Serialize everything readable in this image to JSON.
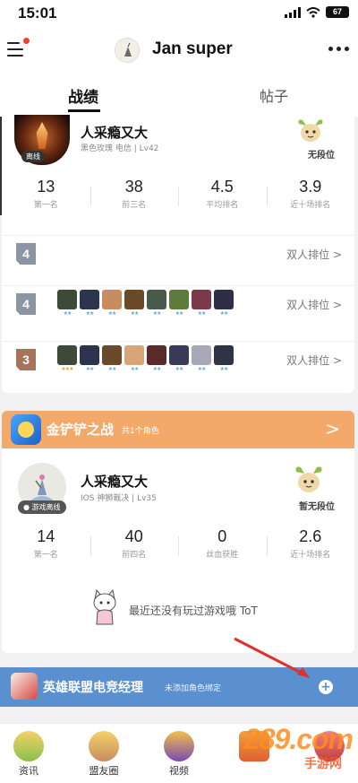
{
  "status_bar": {
    "time": "15:01",
    "battery": "67"
  },
  "header": {
    "username": "Jan  super"
  },
  "tabs": [
    {
      "label": "战绩"
    },
    {
      "label": "帖子"
    }
  ],
  "lol_card": {
    "player_name": "人采瘾又大",
    "player_sub": "黑色玫瑰  电信 | Lv42",
    "status_tag": "离线",
    "rank_label": "无段位",
    "stats": [
      {
        "value": "13",
        "label": "第一名"
      },
      {
        "value": "38",
        "label": "前三名"
      },
      {
        "value": "4.5",
        "label": "平均排名"
      },
      {
        "value": "3.9",
        "label": "近十场排名"
      }
    ],
    "matches": [
      {
        "place": "4",
        "mode": "双人排位 >"
      },
      {
        "place": "4",
        "mode": "双人排位 >"
      },
      {
        "place": "3",
        "mode": ""
      }
    ]
  },
  "golden_shovel": {
    "title": "金铲铲之战",
    "count": "共1个角色",
    "arrow": ">",
    "player_name": "人采瘾又大",
    "player_sub": "IOS 神狮裁决 | Lv35",
    "status_tag": "● 游戏离线",
    "rank_label": "暂无段位",
    "stats": [
      {
        "value": "14",
        "label": "第一名"
      },
      {
        "value": "40",
        "label": "前四名"
      },
      {
        "value": "0",
        "label": "丝血获胜"
      },
      {
        "value": "2.6",
        "label": "近十场排名"
      }
    ],
    "empty_text": "最近还没有玩过游戏哦 ToT"
  },
  "lol_manager": {
    "title": "英雄联盟电竞经理",
    "subtitle": "未添加角色绑定",
    "add": "+"
  },
  "bottom_nav": [
    {
      "label": "资讯"
    },
    {
      "label": "盟友圈"
    },
    {
      "label": "视频"
    },
    {
      "label": ""
    },
    {
      "label": ""
    }
  ],
  "watermark": {
    "text": "289.com",
    "sub": "手游网"
  },
  "colors": {
    "orange_header": "#f2a96a",
    "blue_bar": "#5a8fd0",
    "place_gray": "#8b95a3",
    "place_bronze": "#a7735a",
    "arrow_red": "#e0302a"
  }
}
